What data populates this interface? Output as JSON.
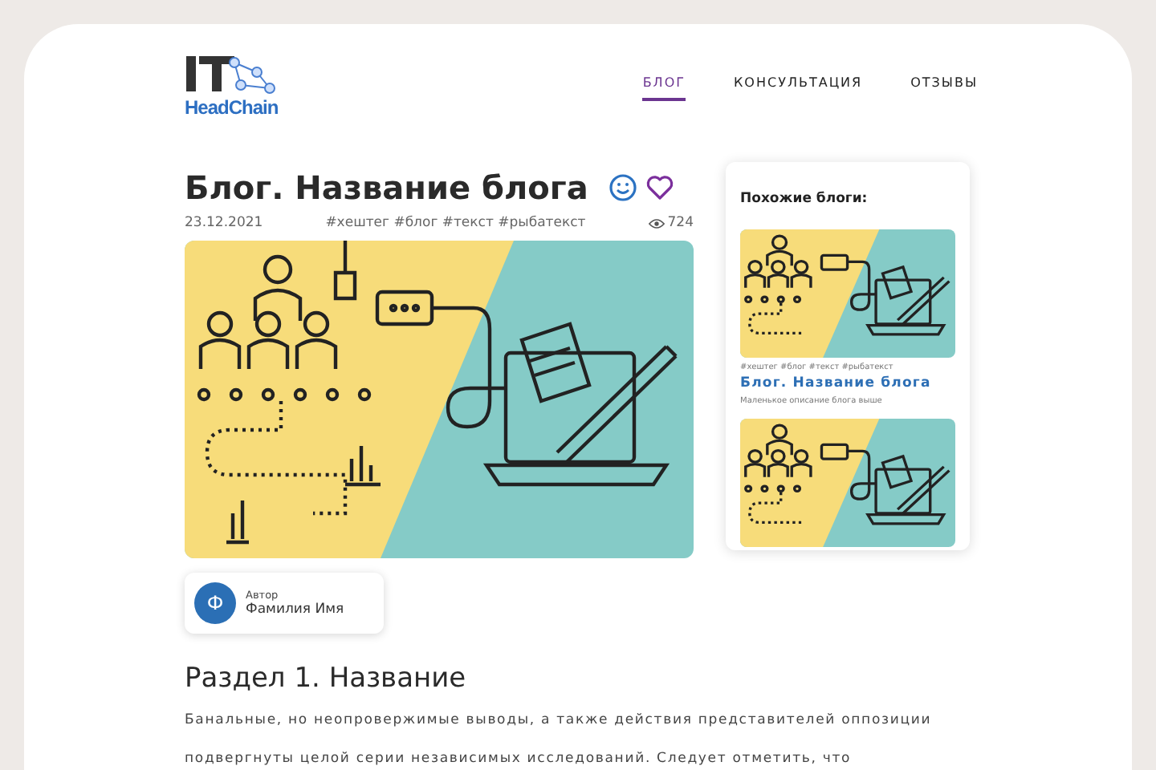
{
  "logo": {
    "text": "HeadChain"
  },
  "nav": [
    {
      "label": "БЛОГ",
      "selected": true
    },
    {
      "label": "КОНСУЛЬТАЦИЯ",
      "selected": false
    },
    {
      "label": "ОТЗЫВЫ",
      "selected": false
    }
  ],
  "post": {
    "title": "Блог. Название блога",
    "date": "23.12.2021",
    "tags": "#хештег #блог #текст #рыбатекст",
    "views": "724",
    "liked": false
  },
  "author": {
    "label": "Автор",
    "name": "Фамилия Имя",
    "initial": "Ф"
  },
  "section": {
    "heading": "Раздел 1. Название",
    "paragraph": "Банальные, но неопровержимые выводы, а также действия представителей оппозиции подвергнуты целой серии независимых исследований. Следует отметить, что"
  },
  "sidebar": {
    "heading": "Похожие блоги:",
    "cards": [
      {
        "kind": "full",
        "tags": "#хештег #блог #текст #рыбатекст",
        "title": "Блог. Название блога",
        "description": "Маленькое описание блога выше"
      },
      {
        "kind": "image_only"
      }
    ]
  }
}
